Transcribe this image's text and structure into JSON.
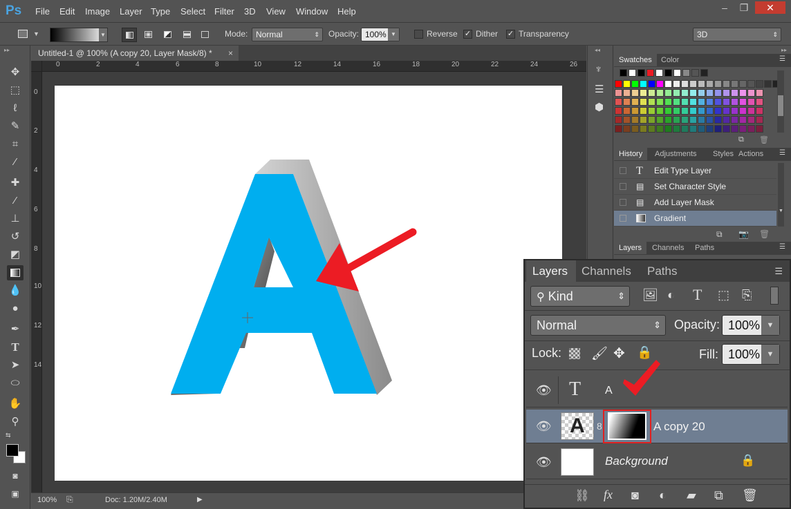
{
  "app": {
    "logo": "Ps"
  },
  "menu": [
    "File",
    "Edit",
    "Image",
    "Layer",
    "Type",
    "Select",
    "Filter",
    "3D",
    "View",
    "Window",
    "Help"
  ],
  "window_buttons": [
    "–",
    "❐",
    "✕"
  ],
  "options": {
    "mode_label": "Mode:",
    "mode_value": "Normal",
    "opacity_label": "Opacity:",
    "opacity_value": "100%",
    "reverse_label": "Reverse",
    "dither_label": "Dither",
    "transparency_label": "Transparency",
    "workspace_value": "3D"
  },
  "document": {
    "tab_title": "Untitled-1 @ 100% (A copy 20, Layer Mask/8) *",
    "tab_close": "×",
    "ruler_h": [
      "0",
      "2",
      "4",
      "6",
      "8",
      "10",
      "12",
      "14",
      "16",
      "18",
      "20",
      "22",
      "24",
      "26"
    ],
    "ruler_v": [
      "0",
      "2",
      "4",
      "6",
      "8",
      "10",
      "12",
      "14"
    ],
    "letter": "A",
    "zoom": "100%",
    "doc_size": "Doc: 1.20M/2.40M"
  },
  "panels": {
    "swatches_tabs": [
      "Swatches",
      "Color"
    ],
    "history_tabs": [
      "History",
      "Adjustments",
      "Styles",
      "Actions"
    ],
    "history_items": [
      {
        "label": "Edit Type Layer",
        "icon": "type-icon",
        "selected": false
      },
      {
        "label": "Set Character Style",
        "icon": "doc-icon",
        "selected": false
      },
      {
        "label": "Add Layer Mask",
        "icon": "doc-icon",
        "selected": false
      },
      {
        "label": "Gradient",
        "icon": "gradient-icon",
        "selected": true
      }
    ],
    "layers_tabs_small": [
      "Layers",
      "Channels",
      "Paths"
    ]
  },
  "layers_zoom": {
    "tabs": [
      "Layers",
      "Channels",
      "Paths"
    ],
    "filter_value": "Kind",
    "blend_value": "Normal",
    "opacity_label": "Opacity:",
    "opacity_value": "100%",
    "lock_label": "Lock:",
    "fill_label": "Fill:",
    "fill_value": "100%",
    "layers": [
      {
        "name": "A",
        "type": "text"
      },
      {
        "name": "A copy 20",
        "type": "masked",
        "selected": true
      },
      {
        "name": "Background",
        "type": "background"
      }
    ]
  },
  "colors": {
    "accent_blue": "#00aeef",
    "arrow_red": "#ec1c24",
    "selection": "#6f7e92"
  }
}
